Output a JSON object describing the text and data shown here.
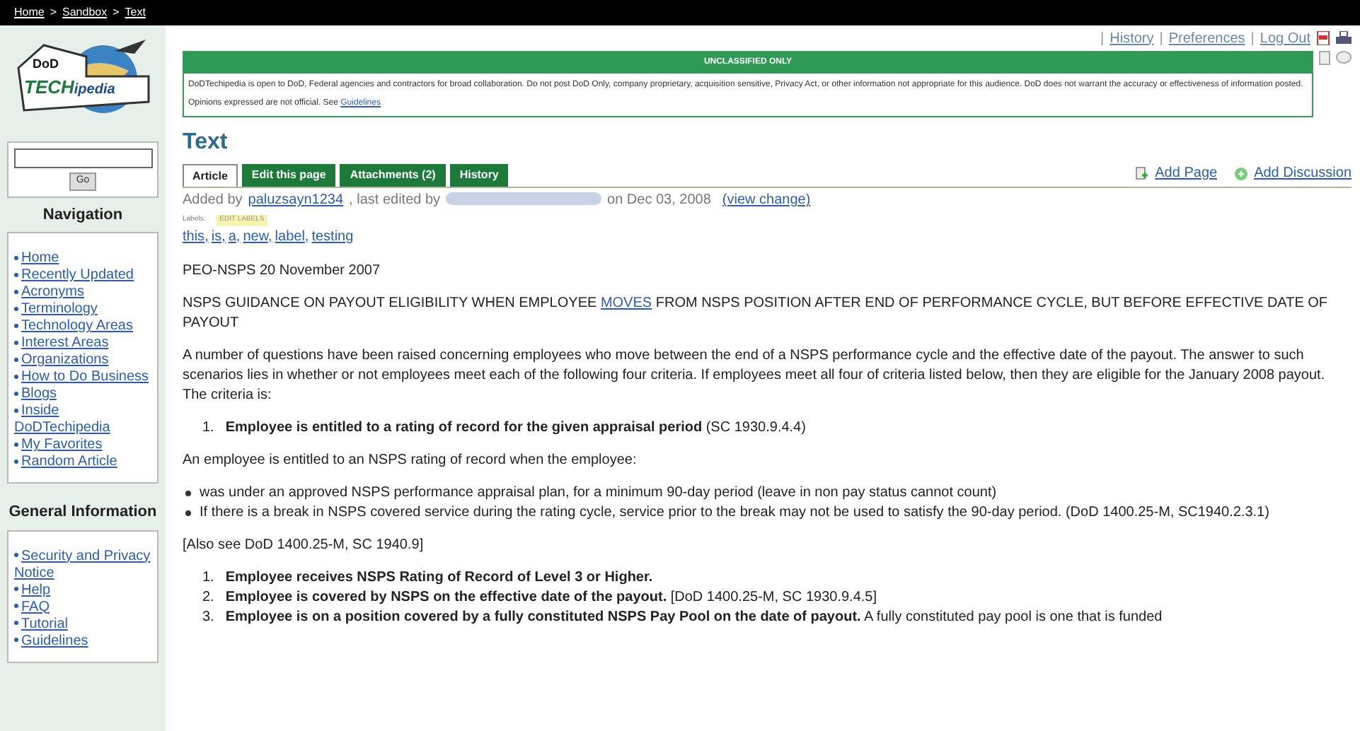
{
  "breadcrumb": [
    {
      "label": "Home"
    },
    {
      "label": "Sandbox"
    },
    {
      "label": "Text"
    }
  ],
  "breadcrumb_separator": ">",
  "logo": {
    "top": "DoD",
    "word_a": "TECH",
    "word_b": "ipedia"
  },
  "search": {
    "button": "Go"
  },
  "top_link_separator": "|",
  "label_separator": ",",
  "top_links": [
    {
      "label": "History"
    },
    {
      "label": "Preferences"
    },
    {
      "label": "Log Out"
    }
  ],
  "banner": {
    "title": "UNCLASSIFIED ONLY",
    "text": "DoDTechipedia is open to DoD, Federal agencies and contractors for broad collaboration. Do not post DoD Only, company proprietary, acquisition sensitive, Privacy Act, or other information not appropriate for this audience. DoD does not warrant the accuracy or effectiveness of information posted. Opinions expressed are not official. See",
    "link": "Guidelines"
  },
  "navigation": {
    "title": "Navigation",
    "items": [
      {
        "label": "Home"
      },
      {
        "label": "Recently Updated"
      },
      {
        "label": "Acronyms"
      },
      {
        "label": "Terminology"
      },
      {
        "label": "Technology Areas"
      },
      {
        "label": "Interest Areas"
      },
      {
        "label": "Organizations"
      },
      {
        "label": "How to Do Business"
      },
      {
        "label": "Blogs"
      },
      {
        "label": "Inside DoDTechipedia"
      },
      {
        "label": "My Favorites"
      },
      {
        "label": "Random Article"
      }
    ]
  },
  "general_information": {
    "title": "General Information",
    "items": [
      {
        "label": "Security and Privacy Notice"
      },
      {
        "label": "Help"
      },
      {
        "label": "FAQ"
      },
      {
        "label": "Tutorial"
      },
      {
        "label": "Guidelines"
      }
    ]
  },
  "page_title": "Text",
  "tabs": [
    {
      "label": "Article",
      "selected": true
    },
    {
      "label": "Edit this page",
      "selected": false
    },
    {
      "label": "Attachments (2)",
      "selected": false
    },
    {
      "label": "History",
      "selected": false
    }
  ],
  "actions": [
    {
      "label": "Add Page",
      "kind": "page"
    },
    {
      "label": "Add Discussion",
      "kind": "discussion"
    }
  ],
  "meta": {
    "added_prefix": "Added by",
    "author": "paluzsayn1234",
    "edited_prefix": ", last edited by",
    "date": "on Dec 03, 2008",
    "change_link": "(view change)"
  },
  "labels": {
    "title": "Labels:",
    "edit": "EDIT LABELS",
    "items": [
      {
        "label": "this"
      },
      {
        "label": "is"
      },
      {
        "label": "a"
      },
      {
        "label": "new"
      },
      {
        "label": "label"
      },
      {
        "label": "testing"
      }
    ]
  },
  "content": [
    {
      "kind": "para",
      "text": "PEO-NSPS 20 November 2007"
    },
    {
      "kind": "heading",
      "before": "NSPS GUIDANCE ON PAYOUT ELIGIBILITY WHEN EMPLOYEE",
      "link": "MOVES",
      "after": "FROM NSPS POSITION AFTER END OF PERFORMANCE CYCLE, BUT BEFORE EFFECTIVE DATE OF PAYOUT"
    },
    {
      "kind": "para",
      "text": "A number of questions have been raised concerning employees who move between the end of a NSPS performance cycle and the effective date of the payout. The answer to such scenarios lies in whether or not employees meet each of the following four criteria. If employees meet all four of criteria listed below, then they are eligible for the January 2008 payout. The criteria is:"
    },
    {
      "kind": "ordered",
      "items": [
        {
          "number": "1.",
          "text": "**Employee is entitled to a rating of record for the given appraisal period** (SC 1930.9.4.4)"
        }
      ]
    },
    {
      "kind": "para",
      "text": "An employee is entitled to an NSPS rating of record when the employee:"
    },
    {
      "kind": "bullets",
      "items": [
        {
          "text": "was under an approved NSPS performance appraisal plan, for a minimum 90-day period (leave in non pay status cannot count)"
        },
        {
          "text": "If there is a break in NSPS covered service during the rating cycle, service prior to the break may not be used to satisfy the 90-day period. (DoD 1400.25-M, SC1940.2.3.1)"
        }
      ]
    },
    {
      "kind": "para",
      "text": "[Also see DoD 1400.25-M, SC 1940.9]"
    },
    {
      "kind": "ordered",
      "items": [
        {
          "number": "1.",
          "text": "**Employee receives NSPS Rating of Record of Level 3 or Higher.**"
        },
        {
          "number": "2.",
          "text": "**Employee is covered by NSPS on the effective date of the payout.** [DoD 1400.25-M, SC 1930.9.4.5]"
        },
        {
          "number": "3.",
          "text": "**Employee is on a position covered by a fully constituted NSPS Pay Pool on the date of payout.** A fully constituted pay pool is one that is funded"
        }
      ]
    }
  ]
}
